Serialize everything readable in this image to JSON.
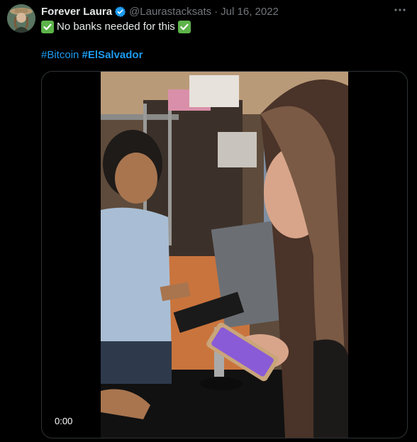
{
  "post": {
    "author_name": "Forever Laura",
    "handle": "@Laurastacksats",
    "separator": "·",
    "date": "Jul 16, 2022",
    "more_icon": "ellipsis-icon",
    "verified_icon": "verified-badge-icon",
    "body_text": "No banks needed for this",
    "check_icon": "check-mark-button-icon",
    "hashtags": [
      "#Bitcoin",
      "#ElSalvador"
    ]
  },
  "media": {
    "type": "video",
    "timecode": "0:00"
  },
  "colors": {
    "background": "#000000",
    "text": "#e7e9ea",
    "secondary": "#71767b",
    "link": "#1d9bf0",
    "verified": "#1d9bf0",
    "check_green": "#5db34a",
    "border": "#2f3336"
  }
}
